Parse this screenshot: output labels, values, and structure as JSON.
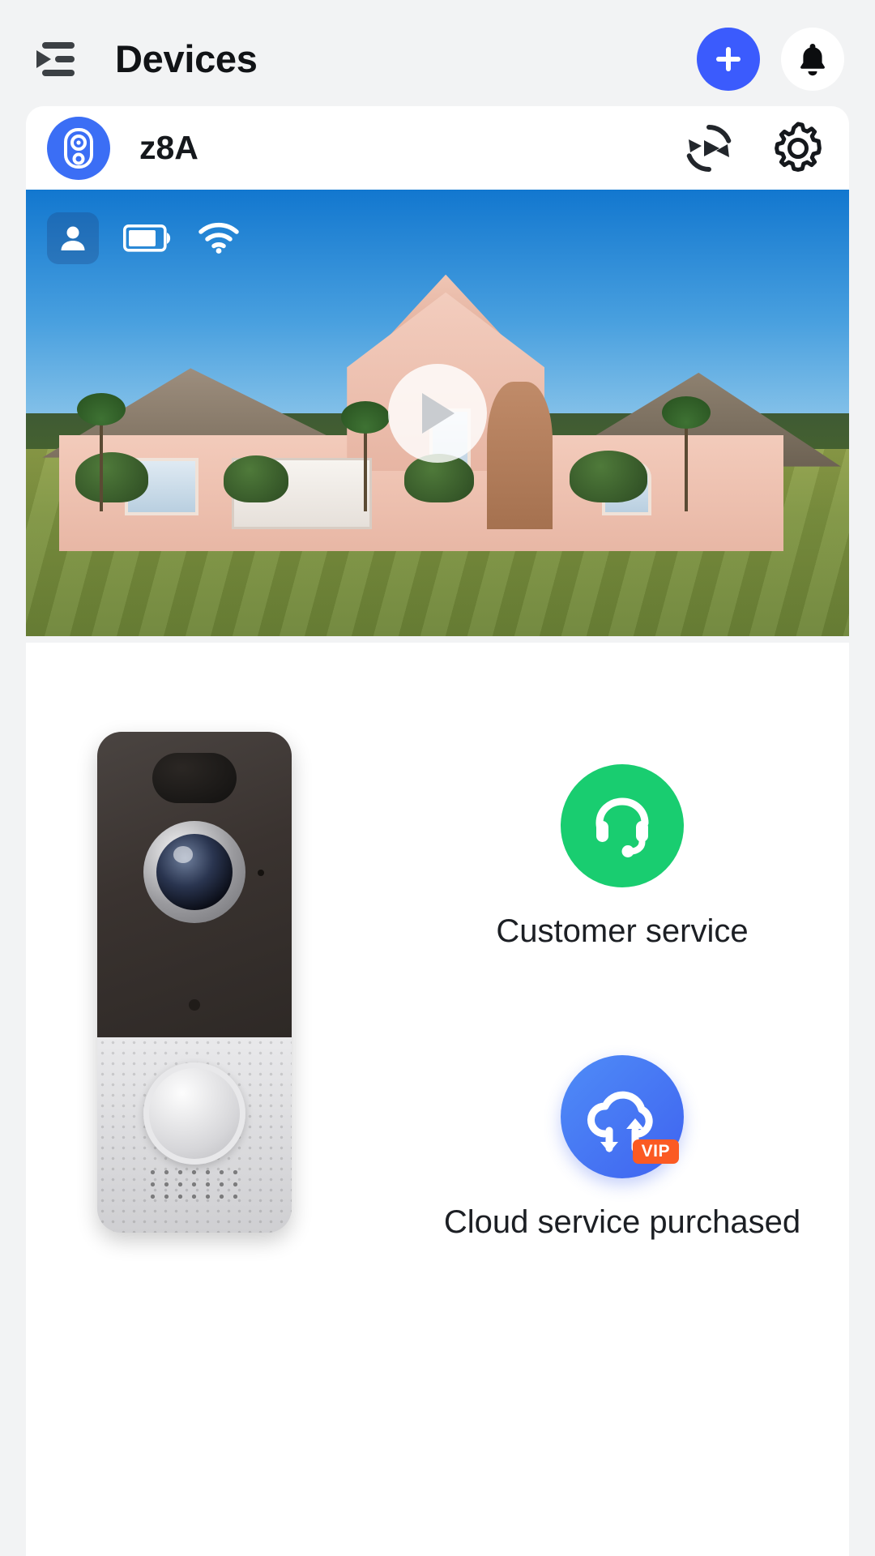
{
  "header": {
    "title": "Devices",
    "menu_icon": "list-menu-icon",
    "add_icon": "plus-icon",
    "notification_icon": "bell-icon",
    "accent_color": "#3b5bfd"
  },
  "device": {
    "name": "z8A",
    "avatar_icon": "doorbell-camera-icon",
    "avatar_color": "#3b6ef5",
    "playback_icon": "playback-replay-icon",
    "settings_icon": "gear-icon",
    "preview": {
      "play_icon": "play-icon",
      "status_icons": [
        {
          "name": "person-detection-icon",
          "label": "person"
        },
        {
          "name": "battery-icon",
          "label": "battery",
          "level": 75
        },
        {
          "name": "wifi-icon",
          "label": "wifi",
          "strength": 3
        }
      ]
    }
  },
  "product": {
    "image_name": "doorbell-product-image"
  },
  "services": [
    {
      "id": "customer-service",
      "label": "Customer service",
      "icon": "headset-icon",
      "color": "#19cd70"
    },
    {
      "id": "cloud-service",
      "label": "Cloud service purchased",
      "icon": "cloud-sync-icon",
      "color": "#3f63f0",
      "badge": "VIP",
      "badge_color": "#fb5a23"
    }
  ]
}
